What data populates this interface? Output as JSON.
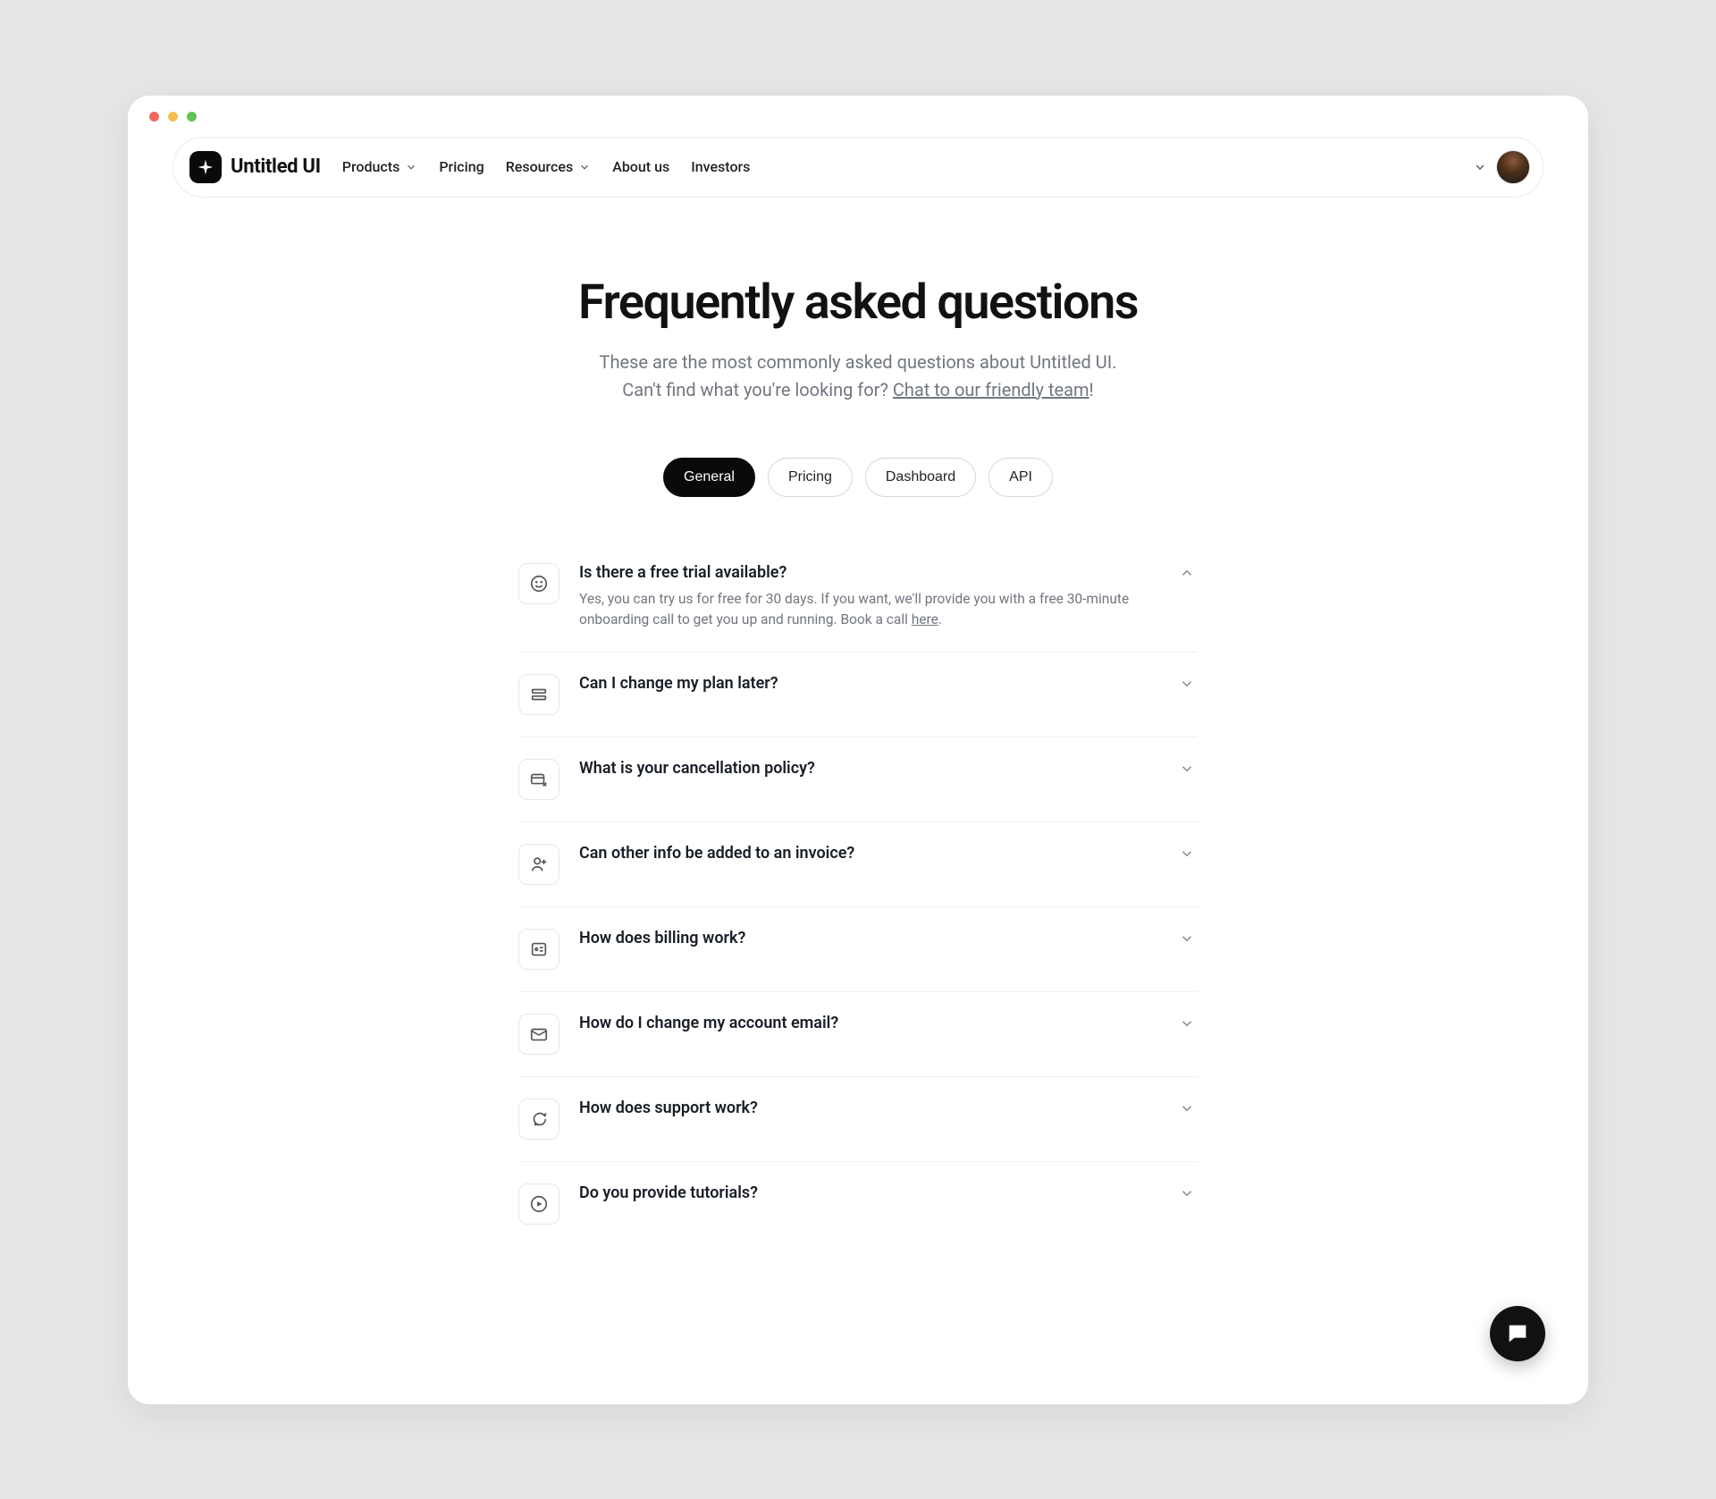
{
  "brand": {
    "name": "Untitled UI"
  },
  "nav": {
    "items": [
      {
        "label": "Products",
        "hasDropdown": true
      },
      {
        "label": "Pricing",
        "hasDropdown": false
      },
      {
        "label": "Resources",
        "hasDropdown": true
      },
      {
        "label": "About us",
        "hasDropdown": false
      },
      {
        "label": "Investors",
        "hasDropdown": false
      }
    ]
  },
  "hero": {
    "title": "Frequently asked questions",
    "subtitle_line1": "These are the most commonly asked questions about Untitled UI.",
    "subtitle_line2_prefix": "Can't find what you're looking for? ",
    "subtitle_link": "Chat to our friendly team",
    "subtitle_suffix": "!"
  },
  "tabs": [
    {
      "label": "General",
      "active": true
    },
    {
      "label": "Pricing",
      "active": false
    },
    {
      "label": "Dashboard",
      "active": false
    },
    {
      "label": "API",
      "active": false
    }
  ],
  "faq": [
    {
      "icon": "smile-icon",
      "question": "Is there a free trial available?",
      "expanded": true,
      "answer_prefix": "Yes, you can try us for free for 30 days. If you want, we'll provide you with a free 30-minute onboarding call to get you up and running. Book a call ",
      "answer_link": "here",
      "answer_suffix": "."
    },
    {
      "icon": "rows-icon",
      "question": "Can I change my plan later?",
      "expanded": false
    },
    {
      "icon": "card-x-icon",
      "question": "What is your cancellation policy?",
      "expanded": false
    },
    {
      "icon": "user-plus-icon",
      "question": "Can other info be added to an invoice?",
      "expanded": false
    },
    {
      "icon": "receipt-icon",
      "question": "How does billing work?",
      "expanded": false
    },
    {
      "icon": "mail-icon",
      "question": "How do I change my account email?",
      "expanded": false
    },
    {
      "icon": "message-icon",
      "question": "How does support work?",
      "expanded": false
    },
    {
      "icon": "play-circle-icon",
      "question": "Do you provide tutorials?",
      "expanded": false
    }
  ]
}
